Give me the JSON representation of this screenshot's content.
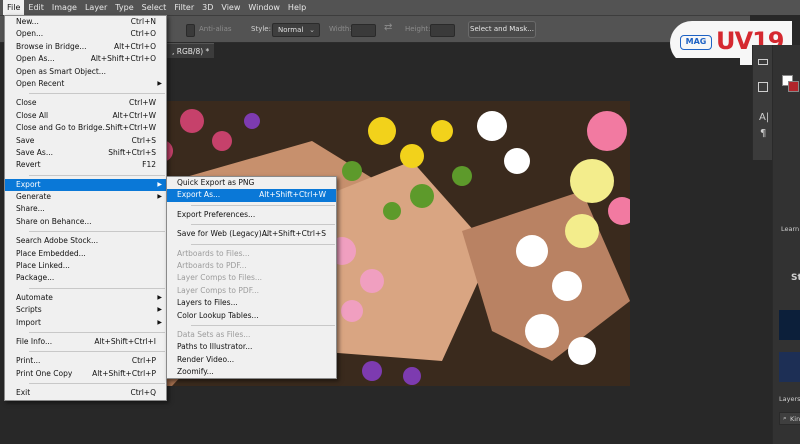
{
  "menubar": {
    "items": [
      "File",
      "Edit",
      "Image",
      "Layer",
      "Type",
      "Select",
      "Filter",
      "3D",
      "View",
      "Window",
      "Help"
    ]
  },
  "options": {
    "antialias": "Anti-alias",
    "style_label": "Style:",
    "style_value": "Normal",
    "width_label": "Width:",
    "height_label": "Height:",
    "swap_glyph": "⇄",
    "select_mask": "Select and Mask..."
  },
  "document": {
    "tab_title": ", RGB/8) *"
  },
  "logo": {
    "mag": "MAG",
    "brand": "UV19"
  },
  "right_panel": {
    "learn": "Learn",
    "layers": "Layers",
    "search": "Kin",
    "st": "St"
  },
  "file_menu": [
    {
      "label": "New...",
      "shortcut": "Ctrl+N"
    },
    {
      "label": "Open...",
      "shortcut": "Ctrl+O"
    },
    {
      "label": "Browse in Bridge...",
      "shortcut": "Alt+Ctrl+O"
    },
    {
      "label": "Open As...",
      "shortcut": "Alt+Shift+Ctrl+O"
    },
    {
      "label": "Open as Smart Object...",
      "shortcut": ""
    },
    {
      "label": "Open Recent",
      "shortcut": "",
      "submenu": true
    },
    {
      "sep": true
    },
    {
      "label": "Close",
      "shortcut": "Ctrl+W"
    },
    {
      "label": "Close All",
      "shortcut": "Alt+Ctrl+W"
    },
    {
      "label": "Close and Go to Bridge...",
      "shortcut": "Shift+Ctrl+W"
    },
    {
      "label": "Save",
      "shortcut": "Ctrl+S"
    },
    {
      "label": "Save As...",
      "shortcut": "Shift+Ctrl+S"
    },
    {
      "label": "Revert",
      "shortcut": "F12"
    },
    {
      "sep": true
    },
    {
      "label": "Export",
      "shortcut": "",
      "submenu": true,
      "highlighted": true
    },
    {
      "label": "Generate",
      "shortcut": "",
      "submenu": true
    },
    {
      "label": "Share...",
      "shortcut": ""
    },
    {
      "label": "Share on Behance...",
      "shortcut": ""
    },
    {
      "sep": true
    },
    {
      "label": "Search Adobe Stock...",
      "shortcut": ""
    },
    {
      "label": "Place Embedded...",
      "shortcut": ""
    },
    {
      "label": "Place Linked...",
      "shortcut": ""
    },
    {
      "label": "Package...",
      "shortcut": ""
    },
    {
      "sep": true
    },
    {
      "label": "Automate",
      "shortcut": "",
      "submenu": true
    },
    {
      "label": "Scripts",
      "shortcut": "",
      "submenu": true
    },
    {
      "label": "Import",
      "shortcut": "",
      "submenu": true
    },
    {
      "sep": true
    },
    {
      "label": "File Info...",
      "shortcut": "Alt+Shift+Ctrl+I"
    },
    {
      "sep": true
    },
    {
      "label": "Print...",
      "shortcut": "Ctrl+P"
    },
    {
      "label": "Print One Copy",
      "shortcut": "Alt+Shift+Ctrl+P"
    },
    {
      "sep": true
    },
    {
      "label": "Exit",
      "shortcut": "Ctrl+Q"
    }
  ],
  "export_menu": [
    {
      "label": "Quick Export as PNG",
      "shortcut": ""
    },
    {
      "label": "Export As...",
      "shortcut": "Alt+Shift+Ctrl+W",
      "highlighted": true
    },
    {
      "sep": true
    },
    {
      "label": "Export Preferences...",
      "shortcut": ""
    },
    {
      "sep": true
    },
    {
      "label": "Save for Web (Legacy)...",
      "shortcut": "Alt+Shift+Ctrl+S"
    },
    {
      "sep": true
    },
    {
      "label": "Artboards to Files...",
      "shortcut": "",
      "disabled": true
    },
    {
      "label": "Artboards to PDF...",
      "shortcut": "",
      "disabled": true
    },
    {
      "label": "Layer Comps to Files...",
      "shortcut": "",
      "disabled": true
    },
    {
      "label": "Layer Comps to PDF...",
      "shortcut": "",
      "disabled": true
    },
    {
      "label": "Layers to Files...",
      "shortcut": ""
    },
    {
      "label": "Color Lookup Tables...",
      "shortcut": ""
    },
    {
      "sep": true
    },
    {
      "label": "Data Sets as Files...",
      "shortcut": "",
      "disabled": true
    },
    {
      "label": "Paths to Illustrator...",
      "shortcut": ""
    },
    {
      "label": "Render Video...",
      "shortcut": ""
    },
    {
      "label": "Zoomify...",
      "shortcut": ""
    }
  ]
}
